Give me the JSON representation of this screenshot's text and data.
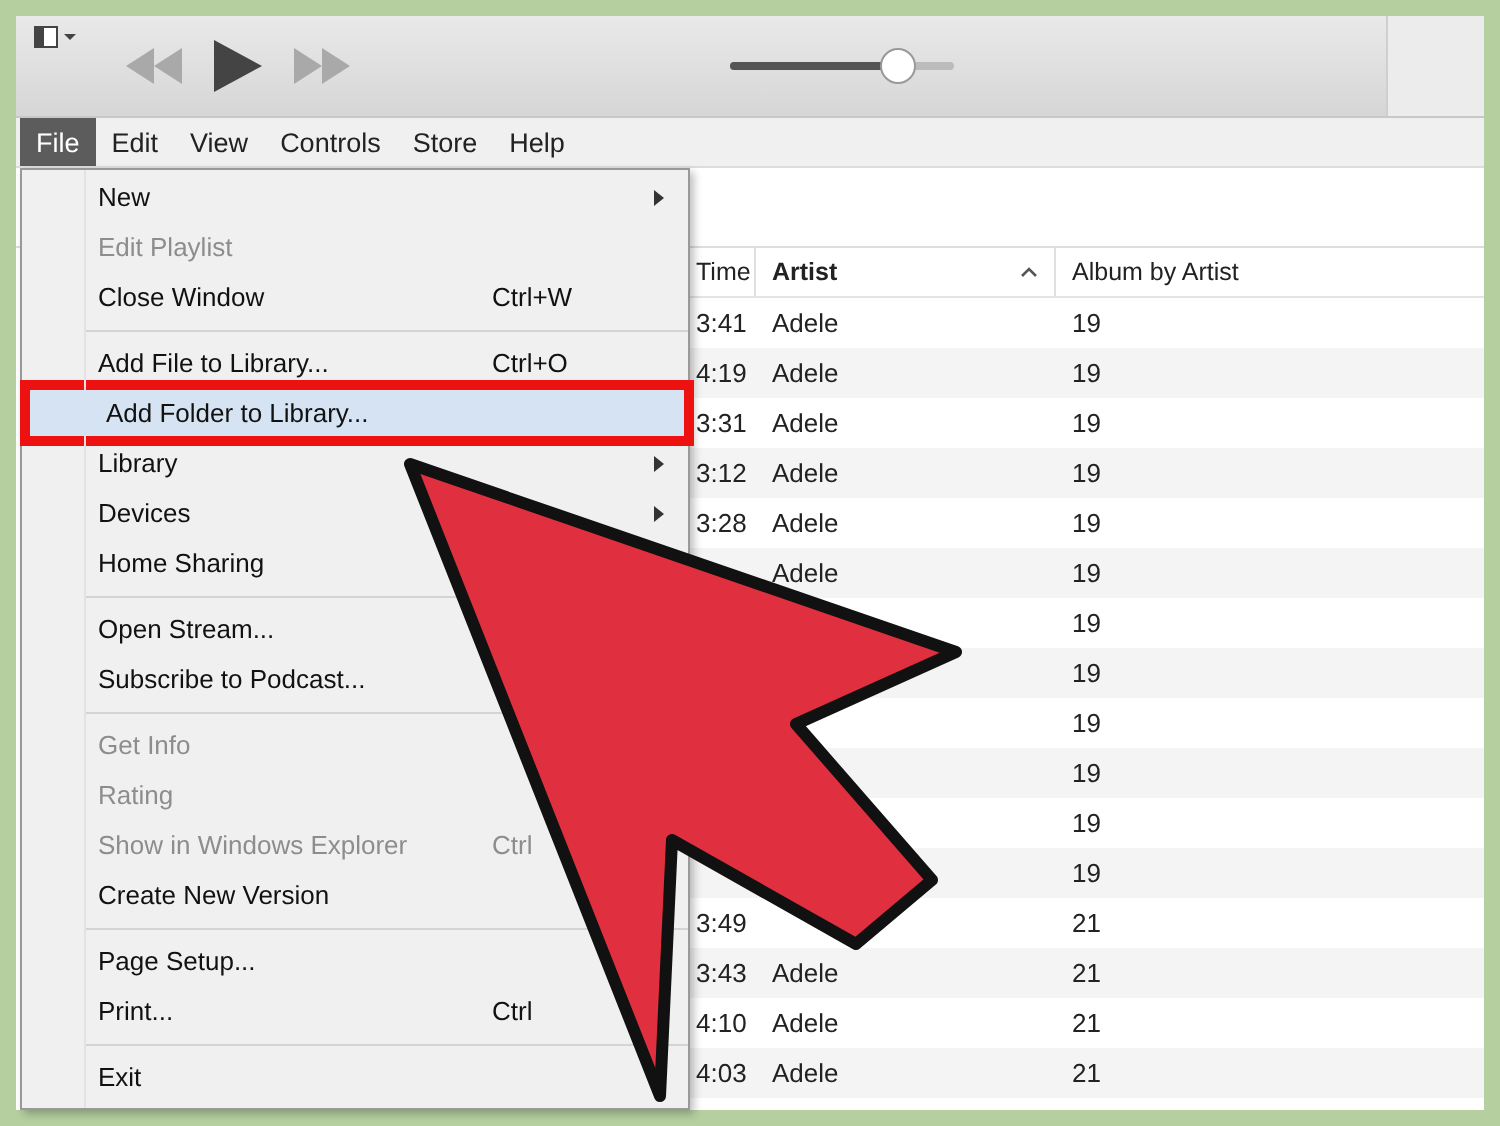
{
  "toolbar": {
    "volume": {
      "level": 0.8
    }
  },
  "menu_bar": [
    {
      "label": "File",
      "selected": true
    },
    {
      "label": "Edit",
      "selected": false
    },
    {
      "label": "View",
      "selected": false
    },
    {
      "label": "Controls",
      "selected": false
    },
    {
      "label": "Store",
      "selected": false
    },
    {
      "label": "Help",
      "selected": false
    }
  ],
  "file_menu": {
    "sections": [
      [
        {
          "label": "New",
          "submenu": true,
          "disabled": false,
          "selected": false
        },
        {
          "label": "Edit Playlist",
          "disabled": true,
          "selected": false
        },
        {
          "label": "Close Window",
          "shortcut": "Ctrl+W",
          "disabled": false,
          "selected": false
        }
      ],
      [
        {
          "label": "Add File to Library...",
          "shortcut": "Ctrl+O",
          "disabled": false,
          "selected": false
        },
        {
          "label": "Add Folder to Library...",
          "disabled": false,
          "selected": true
        },
        {
          "label": "Library",
          "submenu": true,
          "disabled": false,
          "selected": false
        },
        {
          "label": "Devices",
          "submenu": true,
          "disabled": false,
          "selected": false
        },
        {
          "label": "Home Sharing",
          "disabled": false,
          "selected": false
        }
      ],
      [
        {
          "label": "Open Stream...",
          "disabled": false,
          "selected": false
        },
        {
          "label": "Subscribe to Podcast...",
          "disabled": false,
          "selected": false
        }
      ],
      [
        {
          "label": "Get Info",
          "disabled": true,
          "selected": false
        },
        {
          "label": "Rating",
          "disabled": true,
          "selected": false
        },
        {
          "label": "Show in Windows Explorer",
          "shortcut": "Ctrl",
          "disabled": true,
          "selected": false
        },
        {
          "label": "Create New Version",
          "disabled": false,
          "selected": false
        }
      ],
      [
        {
          "label": "Page Setup...",
          "disabled": false,
          "selected": false
        },
        {
          "label": "Print...",
          "shortcut": "Ctrl",
          "disabled": false,
          "selected": false
        }
      ],
      [
        {
          "label": "Exit",
          "disabled": false,
          "selected": false
        }
      ]
    ]
  },
  "table": {
    "columns": [
      {
        "label": "Time",
        "sorted": false
      },
      {
        "label": "Artist",
        "sorted": true
      },
      {
        "label": "Album by Artist",
        "sorted": false
      }
    ],
    "rows": [
      {
        "time": "3:41",
        "artist": "Adele",
        "album": "19"
      },
      {
        "time": "4:19",
        "artist": "Adele",
        "album": "19"
      },
      {
        "time": "3:31",
        "artist": "Adele",
        "album": "19"
      },
      {
        "time": "3:12",
        "artist": "Adele",
        "album": "19"
      },
      {
        "time": "3:28",
        "artist": "Adele",
        "album": "19"
      },
      {
        "artist": "Adele",
        "album": "19"
      },
      {
        "album": "19"
      },
      {
        "album": "19"
      },
      {
        "album": "19"
      },
      {
        "album": "19"
      },
      {
        "album": "19"
      },
      {
        "album": "19"
      },
      {
        "time": "3:49",
        "album": "21"
      },
      {
        "time": "3:43",
        "artist": "Adele",
        "album": "21"
      },
      {
        "time": "4:10",
        "artist": "Adele",
        "album": "21"
      },
      {
        "time": "4:03",
        "artist": "Adele",
        "album": "21"
      }
    ]
  }
}
